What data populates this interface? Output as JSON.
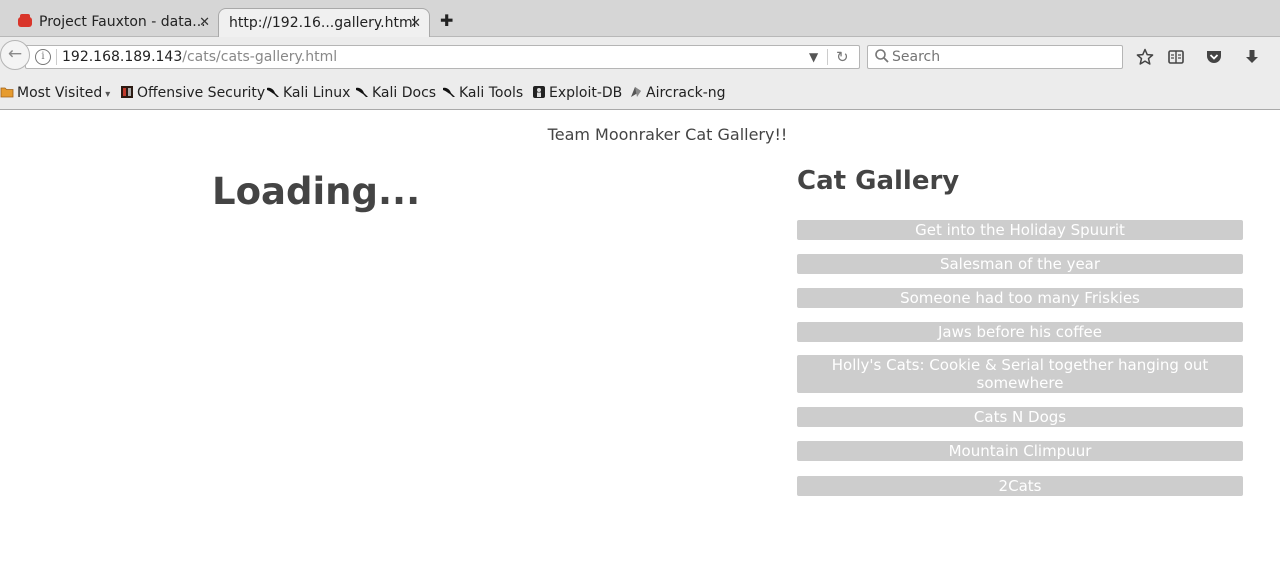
{
  "tabs": [
    {
      "label": "Project Fauxton - data...",
      "close": "✕"
    },
    {
      "label": "http://192.16...gallery.html",
      "close": "✕"
    }
  ],
  "new_tab": "✚",
  "navbar": {
    "back_icon": "←",
    "info_icon": "i",
    "url_host": "192.168.189.143",
    "url_path": "/cats/cats-gallery.html",
    "dropdown_icon": "▼",
    "reload_icon": "↻",
    "search_placeholder": "Search"
  },
  "bookmarks": [
    {
      "label": "Most Visited",
      "caret": "▾",
      "icon": "folder-icon"
    },
    {
      "label": "Offensive Security",
      "icon": "offsec-icon"
    },
    {
      "label": "Kali Linux",
      "icon": "kali-dragon-icon"
    },
    {
      "label": "Kali Docs",
      "icon": "kali-dragon-icon"
    },
    {
      "label": "Kali Tools",
      "icon": "kali-dragon-icon"
    },
    {
      "label": "Exploit-DB",
      "icon": "exploitdb-icon"
    },
    {
      "label": "Aircrack-ng",
      "icon": "aircrack-icon"
    }
  ],
  "page": {
    "site_title": "Team Moonraker Cat Gallery!!",
    "loading": "Loading...",
    "gallery_title": "Cat Gallery",
    "gallery_items": [
      "Get into the Holiday Spuurit",
      "Salesman of the year",
      "Someone had too many Friskies",
      "Jaws before his coffee",
      "Holly's Cats: Cookie & Serial together hanging out somewhere",
      "Cats N Dogs",
      "Mountain Climpuur",
      "2Cats"
    ]
  }
}
